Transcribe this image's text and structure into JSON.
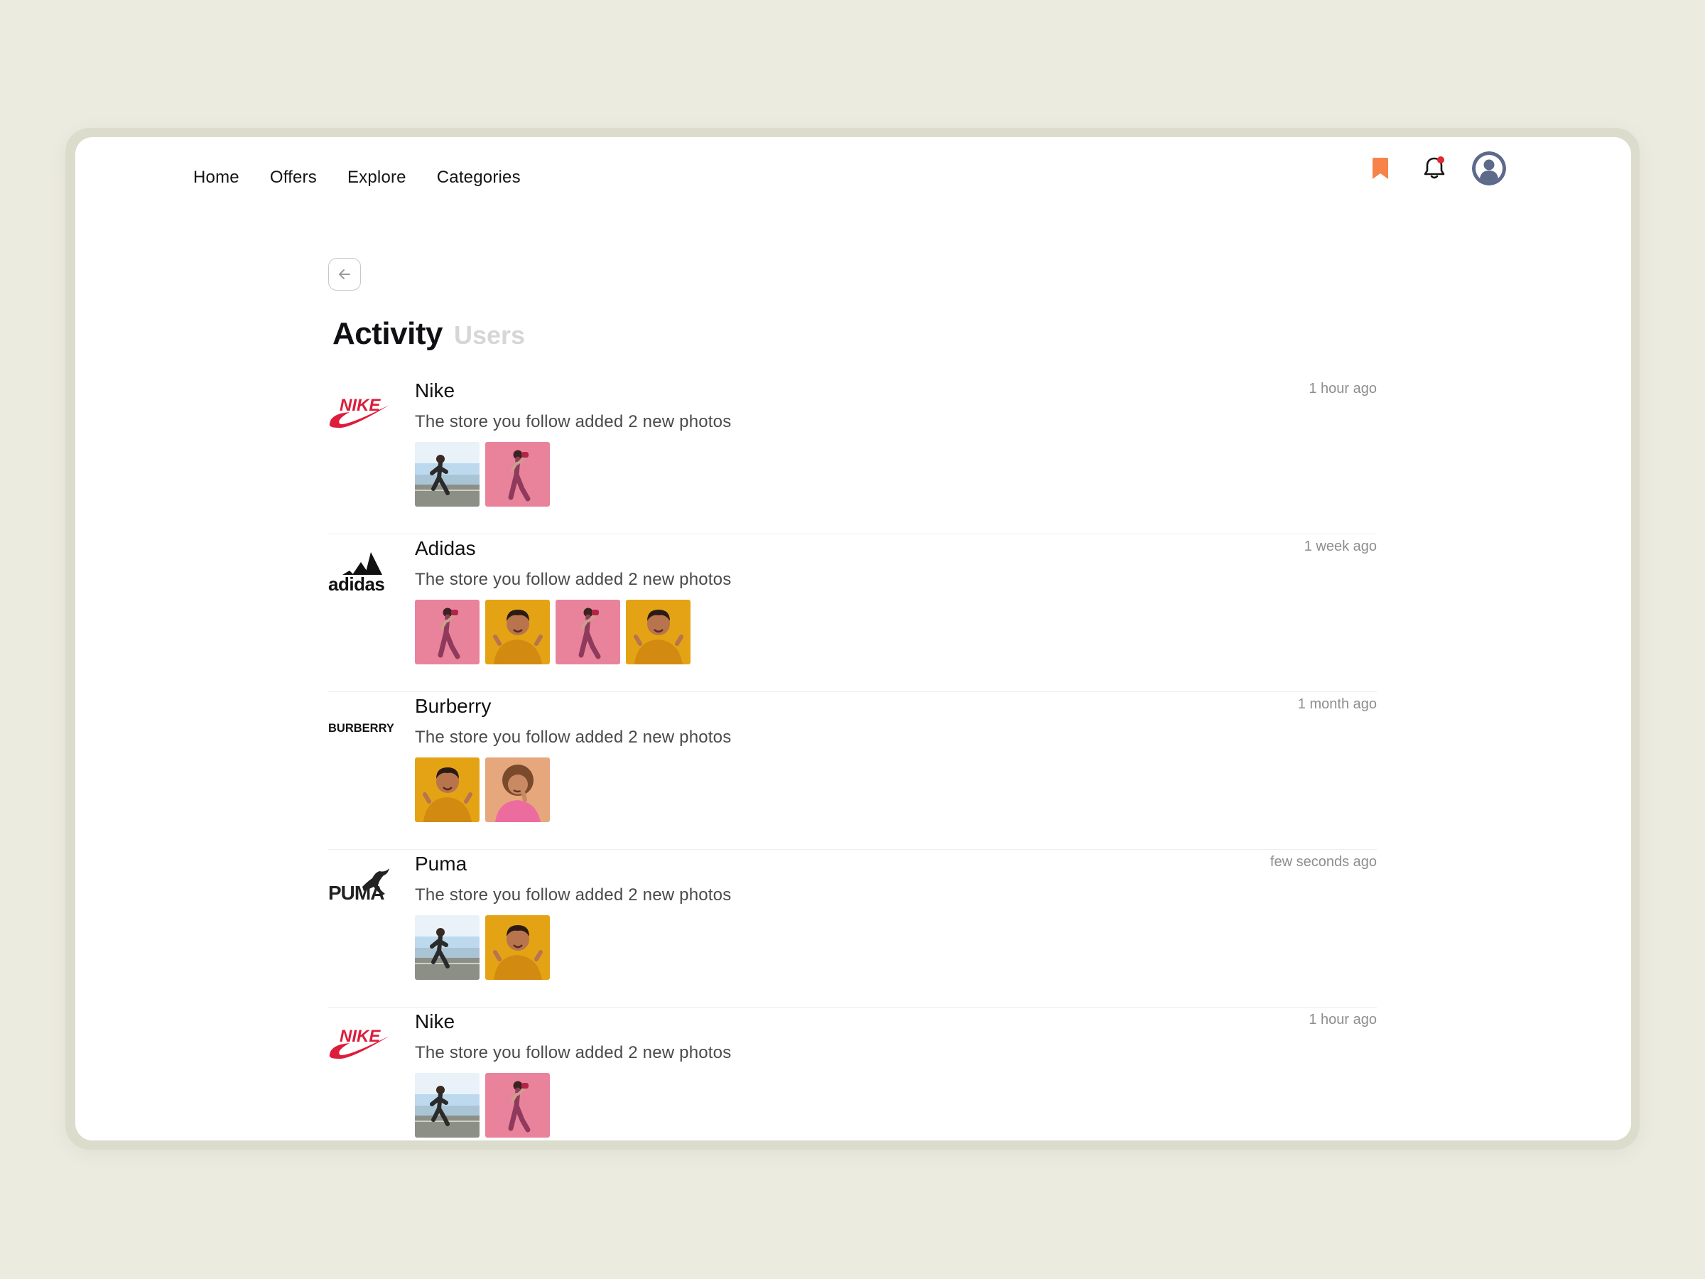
{
  "nav": {
    "items": [
      {
        "label": "Home"
      },
      {
        "label": "Offers"
      },
      {
        "label": "Explore"
      },
      {
        "label": "Categories"
      }
    ]
  },
  "icons": {
    "bookmark": "bookmark-icon",
    "bell": "bell-icon",
    "avatar": "user-avatar",
    "back": "arrow-left-icon"
  },
  "colors": {
    "bookmark": "#f7834a",
    "notification_dot": "#e5262b",
    "nike_red": "#dd1d3a",
    "avatar_bg": "#5d6a8a"
  },
  "heading": {
    "title": "Activity",
    "subtitle": "Users"
  },
  "feed": [
    {
      "store": "Nike",
      "description": "The store you follow added 2 new photos",
      "time": "1 hour ago",
      "logo": "nike",
      "photos": [
        "runner-beach",
        "woman-pink"
      ]
    },
    {
      "store": "Adidas",
      "description": "The store you follow added 2 new photos",
      "time": "1 week ago",
      "logo": "adidas",
      "photos": [
        "woman-pink",
        "smiling-yellow",
        "woman-pink",
        "smiling-yellow"
      ]
    },
    {
      "store": "Burberry",
      "description": "The store you follow added 2 new photos",
      "time": "1 month ago",
      "logo": "burberry",
      "logo_text": "BURBERRY",
      "photos": [
        "smiling-yellow",
        "curly-orange"
      ]
    },
    {
      "store": "Puma",
      "description": "The store you follow added 2 new photos",
      "time": "few seconds ago",
      "logo": "puma",
      "logo_text": "PUMA",
      "photos": [
        "runner-beach",
        "smiling-yellow"
      ]
    },
    {
      "store": "Nike",
      "description": "The store you follow added 2 new photos",
      "time": "1 hour ago",
      "logo": "nike",
      "photos": [
        "runner-beach",
        "woman-pink"
      ]
    }
  ]
}
